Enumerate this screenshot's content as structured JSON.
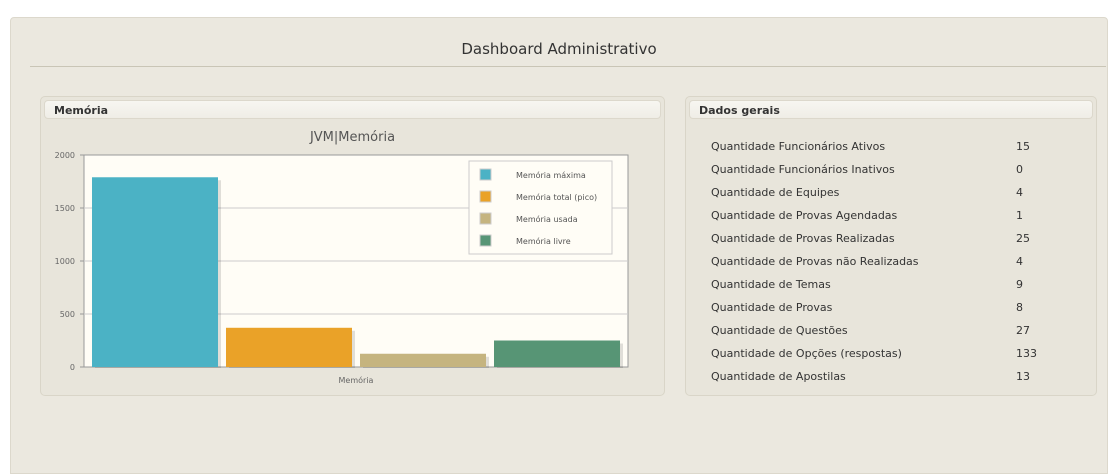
{
  "dashboard": {
    "title": "Dashboard Administrativo"
  },
  "memory_panel": {
    "header": "Memória",
    "chart_title": "JVM|Memória"
  },
  "chart_data": {
    "type": "bar",
    "title": "JVM|Memória",
    "categories": [
      "Memória"
    ],
    "xlabel": "Memória",
    "ylabel": "",
    "ylim": [
      0,
      2000
    ],
    "yticks": [
      0,
      500,
      1000,
      1500,
      2000
    ],
    "legend_position": "top-right",
    "grid": true,
    "series": [
      {
        "name": "Memória máxima",
        "values": [
          1790
        ],
        "color": "#4bb2c5"
      },
      {
        "name": "Memória total (pico)",
        "values": [
          370
        ],
        "color": "#eaa228"
      },
      {
        "name": "Memória usada",
        "values": [
          125
        ],
        "color": "#c5b47f"
      },
      {
        "name": "Memória livre",
        "values": [
          250
        ],
        "color": "#579575"
      }
    ]
  },
  "stats_panel": {
    "header": "Dados gerais",
    "rows": [
      {
        "label": "Quantidade Funcionários Ativos",
        "value": "15"
      },
      {
        "label": "Quantidade Funcionários Inativos",
        "value": "0"
      },
      {
        "label": "Quantidade de Equipes",
        "value": "4"
      },
      {
        "label": "Quantidade de Provas Agendadas",
        "value": "1"
      },
      {
        "label": "Quantidade de Provas Realizadas",
        "value": "25"
      },
      {
        "label": "Quantidade de Provas não Realizadas",
        "value": "4"
      },
      {
        "label": "Quantidade de Temas",
        "value": "9"
      },
      {
        "label": "Quantidade de Provas",
        "value": "8"
      },
      {
        "label": "Quantidade de Questões",
        "value": "27"
      },
      {
        "label": "Quantidade de Opções (respostas)",
        "value": "133"
      },
      {
        "label": "Quantidade de Apostilas",
        "value": "13"
      }
    ]
  }
}
